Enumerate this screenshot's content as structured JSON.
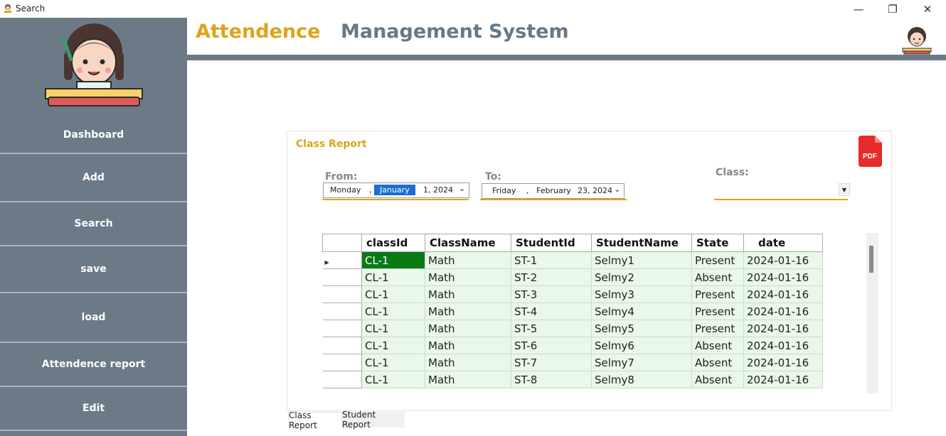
{
  "window": {
    "title": "Search",
    "minimize_glyph": "—",
    "restore_glyph": "❐",
    "close_glyph": "✕"
  },
  "sidebar": {
    "items": [
      {
        "label": "Dashboard"
      },
      {
        "label": "Add"
      },
      {
        "label": "Search"
      },
      {
        "label": "save"
      },
      {
        "label": "load"
      },
      {
        "label": "Attendence report"
      },
      {
        "label": "Edit"
      }
    ]
  },
  "header": {
    "title_part1": "Attendence",
    "title_part2": "Management System"
  },
  "report": {
    "title": "Class Report",
    "pdf_label": "PDF",
    "from_label": "From:",
    "to_label": "To:",
    "class_label": "Class:",
    "from_date": {
      "weekday": "Monday",
      "month": "January",
      "day_year": "1, 2024"
    },
    "to_date": {
      "weekday": "Friday",
      "month": "February",
      "day_year": "23, 2024"
    },
    "class_value": ""
  },
  "table": {
    "columns": [
      "classId",
      "ClassName",
      "StudentId",
      "StudentName",
      "State",
      "date"
    ],
    "rows": [
      [
        "CL-1",
        "Math",
        "ST-1",
        "Selmy1",
        "Present",
        "2024-01-16"
      ],
      [
        "CL-1",
        "Math",
        "ST-2",
        "Selmy2",
        "Absent",
        "2024-01-16"
      ],
      [
        "CL-1",
        "Math",
        "ST-3",
        "Selmy3",
        "Present",
        "2024-01-16"
      ],
      [
        "CL-1",
        "Math",
        "ST-4",
        "Selmy4",
        "Present",
        "2024-01-16"
      ],
      [
        "CL-1",
        "Math",
        "ST-5",
        "Selmy5",
        "Present",
        "2024-01-16"
      ],
      [
        "CL-1",
        "Math",
        "ST-6",
        "Selmy6",
        "Absent",
        "2024-01-16"
      ],
      [
        "CL-1",
        "Math",
        "ST-7",
        "Selmy7",
        "Absent",
        "2024-01-16"
      ],
      [
        "CL-1",
        "Math",
        "ST-8",
        "Selmy8",
        "Absent",
        "2024-01-16"
      ]
    ]
  },
  "tabs": [
    {
      "label": "Class Report"
    },
    {
      "label": "Student Report"
    }
  ],
  "colors": {
    "accent": "#e0a21c",
    "sidebar": "#6c7a88",
    "selected_cell": "#0a7a16",
    "row_bg": "#e9f8e9"
  }
}
